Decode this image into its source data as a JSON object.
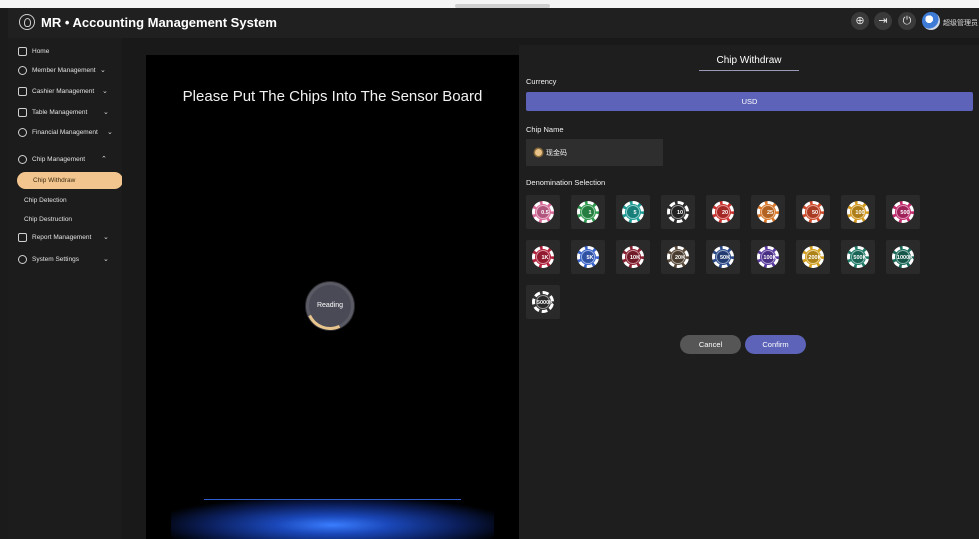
{
  "header": {
    "title": "MR • Accounting Management System",
    "icons": [
      "globe-icon",
      "logout-icon",
      "power-icon"
    ],
    "username": "超级管理员"
  },
  "sidebar": {
    "items": [
      {
        "label": "Home",
        "icon": "home-icon",
        "expandable": false
      },
      {
        "label": "Member Management",
        "icon": "users-icon",
        "expandable": true
      },
      {
        "label": "Cashier Management",
        "icon": "cashier-icon",
        "expandable": true
      },
      {
        "label": "Table Management",
        "icon": "table-icon",
        "expandable": true
      },
      {
        "label": "Financial Management",
        "icon": "yen-icon",
        "expandable": true
      },
      {
        "label": "Chip Management",
        "icon": "chip-icon",
        "expandable": true,
        "expanded": true
      },
      {
        "label": "Report Management",
        "icon": "report-icon",
        "expandable": true
      },
      {
        "label": "System Settings",
        "icon": "gear-icon",
        "expandable": true
      }
    ],
    "chip_subitems": [
      {
        "label": "Chip Withdraw",
        "active": true
      },
      {
        "label": "Chip Detection",
        "active": false
      },
      {
        "label": "Chip Destruction",
        "active": false
      }
    ]
  },
  "sensor": {
    "title": "Please Put The Chips Into The Sensor Board",
    "status": "Reading"
  },
  "panel": {
    "title": "Chip Withdraw",
    "currency_label": "Currency",
    "currency_value": "USD",
    "chip_name_label": "Chip Name",
    "chip_name_value": "现金码",
    "denomination_label": "Denomination Selection",
    "denominations": [
      {
        "label": "0.5",
        "color": "#d86a9a"
      },
      {
        "label": "1",
        "color": "#2e9a4e"
      },
      {
        "label": "5",
        "color": "#1f9c95"
      },
      {
        "label": "10",
        "color": "#2a2a2a"
      },
      {
        "label": "20",
        "color": "#c9322f"
      },
      {
        "label": "25",
        "color": "#d9782a"
      },
      {
        "label": "50",
        "color": "#cf4a2a"
      },
      {
        "label": "100",
        "color": "#d49a1f"
      },
      {
        "label": "500",
        "color": "#c22a6e"
      },
      {
        "label": "1K",
        "color": "#b2203a"
      },
      {
        "label": "5K",
        "color": "#3a63c9"
      },
      {
        "label": "10K",
        "color": "#8a2030"
      },
      {
        "label": "20K",
        "color": "#5a4a3a"
      },
      {
        "label": "50K",
        "color": "#2a4a8a"
      },
      {
        "label": "100K",
        "color": "#5a3aa0"
      },
      {
        "label": "200K",
        "color": "#d4a01f"
      },
      {
        "label": "500K",
        "color": "#1f7a68"
      },
      {
        "label": "1000K",
        "color": "#1a6a5a"
      },
      {
        "label": "5000K",
        "color": "#333333"
      }
    ],
    "cancel_label": "Cancel",
    "confirm_label": "Confirm"
  }
}
